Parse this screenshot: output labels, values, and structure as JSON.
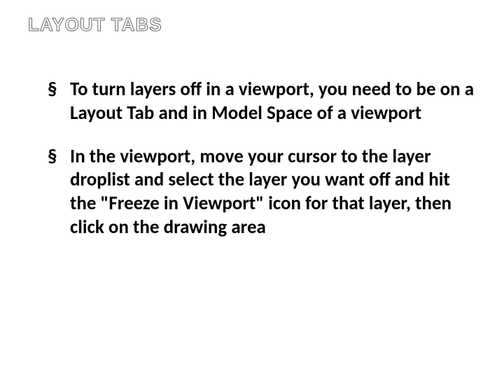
{
  "slide": {
    "title": "LAYOUT TABS",
    "bullets": [
      "To turn layers off in a viewport, you need to be on a Layout Tab and in Model Space of a viewport",
      "In the viewport, move your cursor to the layer droplist and select the layer you want off and hit the \"Freeze in Viewport\" icon for that layer, then click on the drawing area"
    ]
  }
}
